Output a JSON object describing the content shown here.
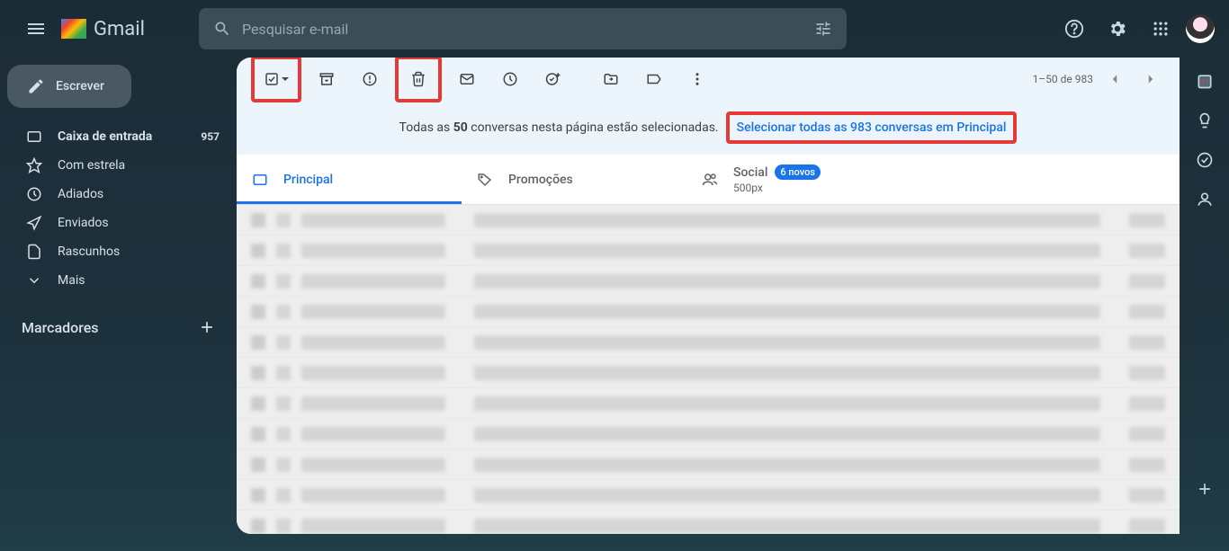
{
  "header": {
    "logo_text": "Gmail",
    "search_placeholder": "Pesquisar e-mail"
  },
  "sidebar": {
    "compose_label": "Escrever",
    "items": [
      {
        "label": "Caixa de entrada",
        "count": "957",
        "icon": "inbox"
      },
      {
        "label": "Com estrela",
        "icon": "star"
      },
      {
        "label": "Adiados",
        "icon": "clock"
      },
      {
        "label": "Enviados",
        "icon": "send"
      },
      {
        "label": "Rascunhos",
        "icon": "file"
      },
      {
        "label": "Mais",
        "icon": "chevron"
      }
    ],
    "labels_header": "Marcadores"
  },
  "toolbar": {
    "pagination_text": "1–50 de 983"
  },
  "banner": {
    "text_prefix": "Todas as ",
    "count": "50",
    "text_suffix": " conversas nesta página estão selecionadas.",
    "link_text": "Selecionar todas as 983 conversas em Principal"
  },
  "tabs": {
    "primary": "Principal",
    "promotions": "Promoções",
    "social": "Social",
    "social_badge": "6 novos",
    "social_sub": "500px"
  }
}
